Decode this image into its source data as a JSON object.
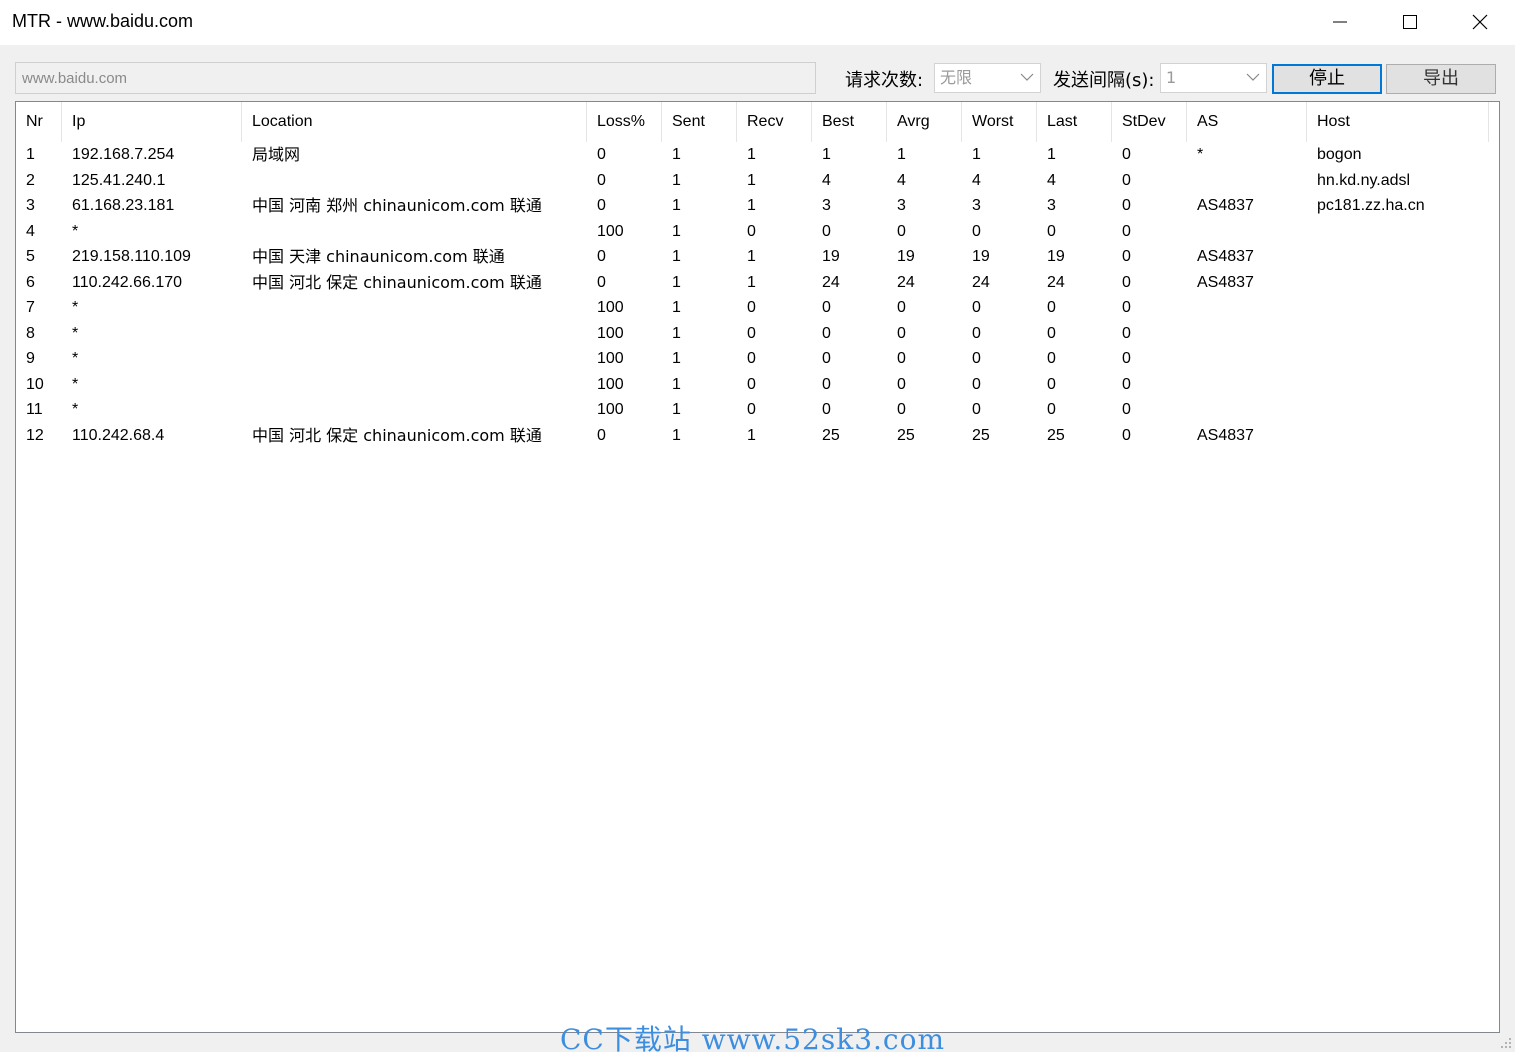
{
  "window": {
    "title": "MTR - www.baidu.com"
  },
  "toolbar": {
    "target_value": "www.baidu.com",
    "request_count_label": "请求次数:",
    "request_count_value": "无限",
    "interval_label": "发送间隔(s):",
    "interval_value": "1",
    "stop_label": "停止",
    "export_label": "导出"
  },
  "table": {
    "columns": [
      "Nr",
      "Ip",
      "Location",
      "Loss%",
      "Sent",
      "Recv",
      "Best",
      "Avrg",
      "Worst",
      "Last",
      "StDev",
      "AS",
      "Host"
    ],
    "rows": [
      [
        "1",
        "192.168.7.254",
        "局域网",
        "0",
        "1",
        "1",
        "1",
        "1",
        "1",
        "1",
        "0",
        "*",
        "bogon"
      ],
      [
        "2",
        "125.41.240.1",
        "",
        "0",
        "1",
        "1",
        "4",
        "4",
        "4",
        "4",
        "0",
        "",
        "hn.kd.ny.adsl"
      ],
      [
        "3",
        "61.168.23.181",
        "中国 河南 郑州 chinaunicom.com 联通",
        "0",
        "1",
        "1",
        "3",
        "3",
        "3",
        "3",
        "0",
        "AS4837",
        "pc181.zz.ha.cn"
      ],
      [
        "4",
        "*",
        "",
        "100",
        "1",
        "0",
        "0",
        "0",
        "0",
        "0",
        "0",
        "",
        ""
      ],
      [
        "5",
        "219.158.110.109",
        "中国 天津 chinaunicom.com 联通",
        "0",
        "1",
        "1",
        "19",
        "19",
        "19",
        "19",
        "0",
        "AS4837",
        ""
      ],
      [
        "6",
        "110.242.66.170",
        "中国 河北 保定 chinaunicom.com 联通",
        "0",
        "1",
        "1",
        "24",
        "24",
        "24",
        "24",
        "0",
        "AS4837",
        ""
      ],
      [
        "7",
        "*",
        "",
        "100",
        "1",
        "0",
        "0",
        "0",
        "0",
        "0",
        "0",
        "",
        ""
      ],
      [
        "8",
        "*",
        "",
        "100",
        "1",
        "0",
        "0",
        "0",
        "0",
        "0",
        "0",
        "",
        ""
      ],
      [
        "9",
        "*",
        "",
        "100",
        "1",
        "0",
        "0",
        "0",
        "0",
        "0",
        "0",
        "",
        ""
      ],
      [
        "10",
        "*",
        "",
        "100",
        "1",
        "0",
        "0",
        "0",
        "0",
        "0",
        "0",
        "",
        ""
      ],
      [
        "11",
        "*",
        "",
        "100",
        "1",
        "0",
        "0",
        "0",
        "0",
        "0",
        "0",
        "",
        ""
      ],
      [
        "12",
        "110.242.68.4",
        "中国 河北 保定 chinaunicom.com 联通",
        "0",
        "1",
        "1",
        "25",
        "25",
        "25",
        "25",
        "0",
        "AS4837",
        ""
      ]
    ]
  },
  "watermark": "CC下载站 www.52sk3.com",
  "icons": {
    "minimize": "minimize-icon",
    "maximize": "maximize-icon",
    "close": "close-icon",
    "dropdown": "chevron-down-icon",
    "resize_grip": "resize-grip-icon"
  },
  "colors": {
    "titlebar": "#ffffff",
    "background": "#f0f0f0",
    "primary_button_border": "#0078d7",
    "watermark": "#3e8ee0"
  }
}
